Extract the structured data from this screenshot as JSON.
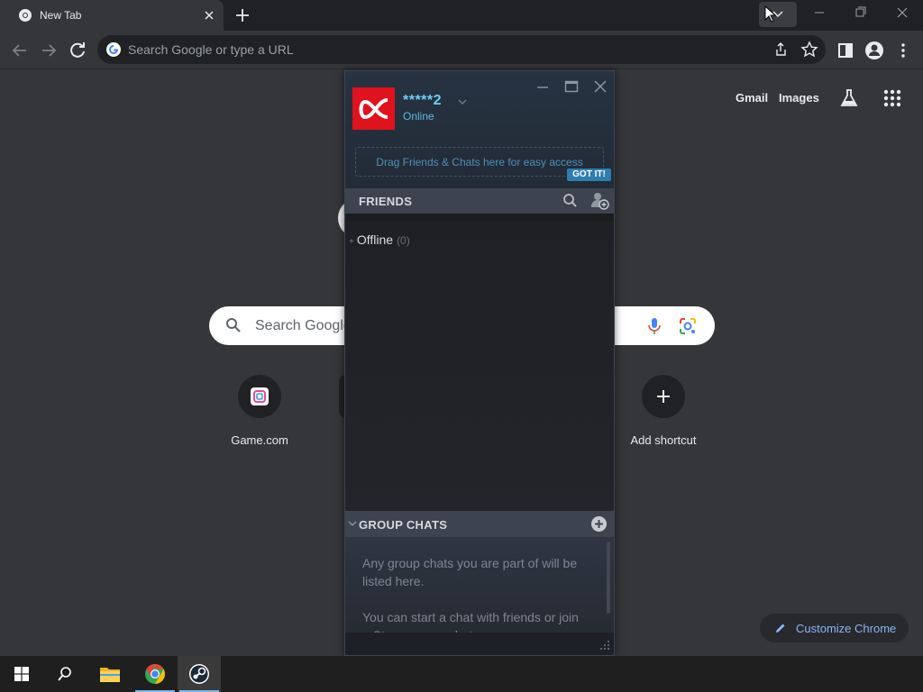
{
  "browser": {
    "tab": {
      "title": "New Tab"
    },
    "omnibox": {
      "placeholder": "Search Google or type a URL"
    }
  },
  "ntp": {
    "links": {
      "gmail": "Gmail",
      "images": "Images"
    },
    "search": {
      "placeholder": "Search Google"
    },
    "shortcuts": [
      {
        "label": "Game.com"
      },
      {
        "label": "Add shortcut"
      }
    ],
    "customize_label": "Customize Chrome"
  },
  "steam": {
    "user": {
      "name": "*****2",
      "status": "Online",
      "avatar_color": "#e0121d"
    },
    "drag_hint": "Drag Friends & Chats here for easy access",
    "got_it": "GOT IT!",
    "friends": {
      "header": "FRIENDS",
      "groups": [
        {
          "name": "Offline",
          "count": "(0)"
        }
      ]
    },
    "group_chats": {
      "header": "GROUP CHATS",
      "message_1": "Any group chats you are part of will be listed here.",
      "message_2": "You can start a chat with friends or join a Steam group chat."
    }
  },
  "taskbar": {
    "items": [
      "start-button",
      "search-button",
      "file-explorer",
      "chrome",
      "steam"
    ],
    "active": "steam"
  },
  "colors": {
    "chrome_bg": "#35363a",
    "steam_accent": "#6dcff6",
    "link_blue": "#8ab4f8"
  }
}
